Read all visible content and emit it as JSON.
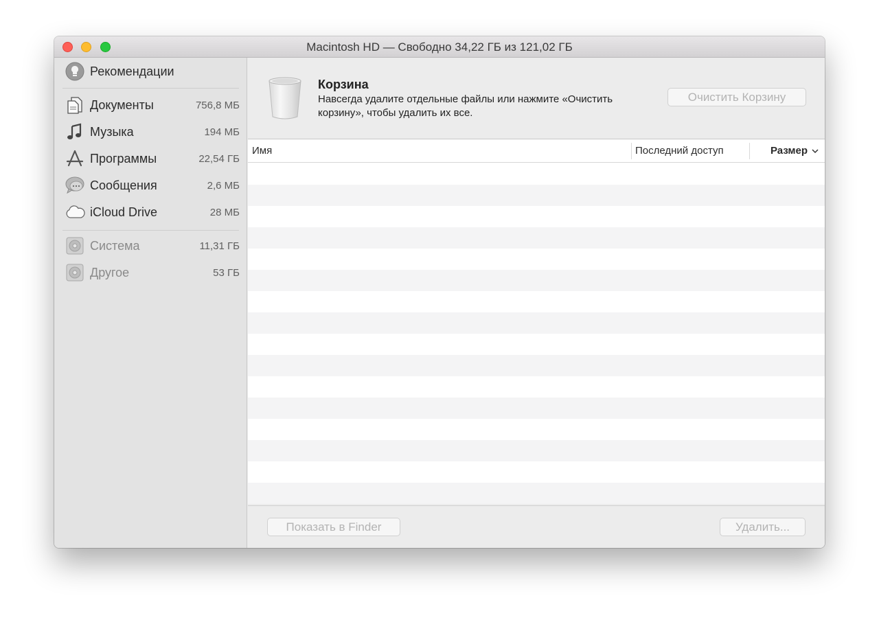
{
  "window": {
    "title": "Macintosh HD — Свободно 34,22 ГБ из 121,02 ГБ"
  },
  "sidebar": {
    "recommendations_label": "Рекомендации",
    "items": [
      {
        "label": "Документы",
        "size": "756,8 МБ",
        "icon": "documents-icon"
      },
      {
        "label": "Музыка",
        "size": "194 МБ",
        "icon": "music-note-icon"
      },
      {
        "label": "Программы",
        "size": "22,54 ГБ",
        "icon": "app-store-icon"
      },
      {
        "label": "Сообщения",
        "size": "2,6 МБ",
        "icon": "messages-icon"
      },
      {
        "label": "iCloud Drive",
        "size": "28 МБ",
        "icon": "cloud-icon"
      }
    ],
    "system_items": [
      {
        "label": "Система",
        "size": "11,31 ГБ",
        "icon": "system-disk-icon"
      },
      {
        "label": "Другое",
        "size": "53 ГБ",
        "icon": "other-disk-icon"
      }
    ]
  },
  "main": {
    "title": "Корзина",
    "description": "Навсегда удалите отдельные файлы или нажмите «Очистить корзину», чтобы удалить их все.",
    "empty_trash_button": "Очистить Корзину",
    "table": {
      "col_name": "Имя",
      "col_last_access": "Последний доступ",
      "col_size": "Размер"
    },
    "show_in_finder_button": "Показать в Finder",
    "delete_button": "Удалить..."
  },
  "colors": {
    "close": "#fe5f57",
    "minimize": "#febc2e",
    "maximize": "#28c840",
    "sidebar_bg": "#e3e3e3",
    "row_alt": "#f4f4f5"
  }
}
